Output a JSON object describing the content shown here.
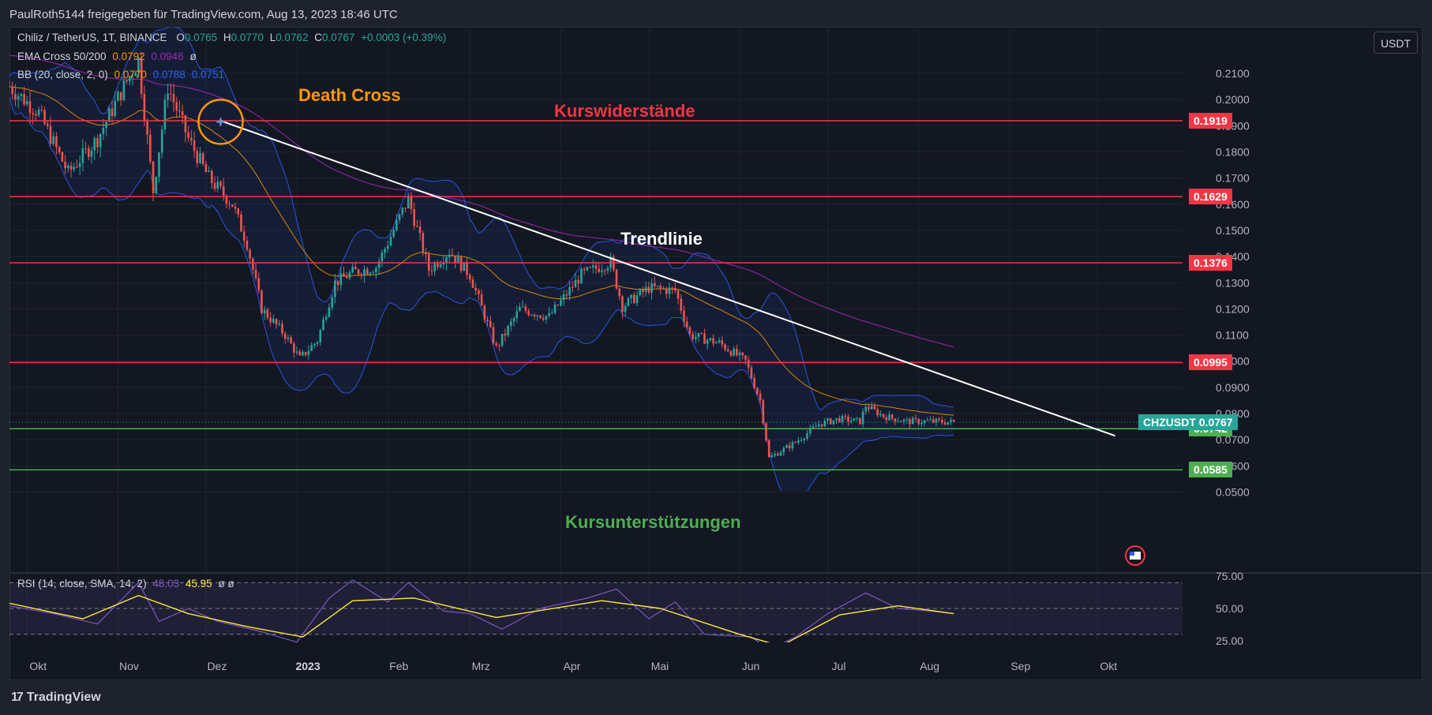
{
  "header": {
    "title": "PaulRoth5144 freigegeben für TradingView.com, Aug 13, 2023 18:46 UTC"
  },
  "legend": {
    "symbol": "Chiliz / TetherUS, 1T, BINANCE",
    "o_label": "O",
    "o_value": "0.0765",
    "h_label": "H",
    "h_value": "0.0770",
    "l_label": "L",
    "l_value": "0.0762",
    "c_label": "C",
    "c_value": "0.0767",
    "change": "+0.0003 (+0.39%)",
    "ema_label": "EMA Cross 50/200",
    "ema_v1": "0.0792",
    "ema_v2": "0.0946",
    "ema_icon": "ø",
    "bb_label": "BB (20, close, 2, 0)",
    "bb_v1": "0.0770",
    "bb_v2": "0.0788",
    "bb_v3": "0.0751",
    "rsi_label": "RSI (14, close, SMA, 14, 2)",
    "rsi_v1": "48.03",
    "rsi_v2": "45.95",
    "rsi_icons": "ø ø"
  },
  "currency_button": "USDT",
  "annotations": {
    "death_cross": "Death Cross",
    "resistance": "Kurswiderstände",
    "trendline": "Trendlinie",
    "support": "Kursunterstützungen"
  },
  "colors": {
    "up": "#26a69a",
    "down": "#ef5350",
    "resistance": "#f23645",
    "support": "#4caf50",
    "ema50": "#ff9800",
    "ema200": "#9c27b0",
    "bb": "#2962ff",
    "rsi": "#7e57c2",
    "rsi_sma": "#ffeb3b",
    "background": "#131722",
    "grid": "#1f2430",
    "text": "#b2b5be"
  },
  "footer": {
    "brand": "TradingView"
  },
  "chart_data": {
    "type": "candlestick",
    "symbol": "CHZUSDT",
    "current_price": "0.0767",
    "y_ticks": [
      "0.2100",
      "0.2000",
      "0.1900",
      "0.1800",
      "0.1700",
      "0.1600",
      "0.1500",
      "0.1400",
      "0.1300",
      "0.1200",
      "0.1100",
      "0.1000",
      "0.0900",
      "0.0800",
      "0.0700",
      "0.0600",
      "0.0500"
    ],
    "ylim": [
      0.048,
      0.225
    ],
    "x_ticks": [
      "Okt",
      "Nov",
      "Dez",
      "2023",
      "Feb",
      "Mrz",
      "Apr",
      "Mai",
      "Jun",
      "Jul",
      "Aug",
      "Sep",
      "Okt"
    ],
    "resistance_levels": [
      {
        "label": "0.1919",
        "value": 0.1919
      },
      {
        "label": "0.1629",
        "value": 0.1629
      },
      {
        "label": "0.1376",
        "value": 0.1376
      },
      {
        "label": "0.0995",
        "value": 0.0995
      }
    ],
    "support_levels": [
      {
        "label": "0.0742",
        "value": 0.0742
      },
      {
        "label": "0.0585",
        "value": 0.0585
      }
    ],
    "trendline": {
      "start": {
        "date": "2022-12-06",
        "price": 0.1919
      },
      "end": {
        "date": "2023-10-07",
        "price": 0.0715
      }
    },
    "death_cross": {
      "date": "2022-12-06",
      "price": 0.1915
    },
    "close_series": [
      {
        "date": "2022-09-25",
        "close": 0.205
      },
      {
        "date": "2022-10-05",
        "close": 0.195
      },
      {
        "date": "2022-10-15",
        "close": 0.172
      },
      {
        "date": "2022-10-25",
        "close": 0.185
      },
      {
        "date": "2022-11-03",
        "close": 0.205
      },
      {
        "date": "2022-11-08",
        "close": 0.215
      },
      {
        "date": "2022-11-13",
        "close": 0.165
      },
      {
        "date": "2022-11-18",
        "close": 0.205
      },
      {
        "date": "2022-11-25",
        "close": 0.185
      },
      {
        "date": "2022-12-02",
        "close": 0.17
      },
      {
        "date": "2022-12-10",
        "close": 0.16
      },
      {
        "date": "2022-12-15",
        "close": 0.145
      },
      {
        "date": "2022-12-20",
        "close": 0.12
      },
      {
        "date": "2022-12-28",
        "close": 0.11
      },
      {
        "date": "2023-01-02",
        "close": 0.101
      },
      {
        "date": "2023-01-08",
        "close": 0.108
      },
      {
        "date": "2023-01-14",
        "close": 0.13
      },
      {
        "date": "2023-01-20",
        "close": 0.134
      },
      {
        "date": "2023-01-28",
        "close": 0.136
      },
      {
        "date": "2023-02-08",
        "close": 0.162
      },
      {
        "date": "2023-02-15",
        "close": 0.135
      },
      {
        "date": "2023-02-22",
        "close": 0.142
      },
      {
        "date": "2023-03-01",
        "close": 0.133
      },
      {
        "date": "2023-03-10",
        "close": 0.105
      },
      {
        "date": "2023-03-18",
        "close": 0.12
      },
      {
        "date": "2023-03-28",
        "close": 0.117
      },
      {
        "date": "2023-04-08",
        "close": 0.133
      },
      {
        "date": "2023-04-18",
        "close": 0.138
      },
      {
        "date": "2023-04-22",
        "close": 0.121
      },
      {
        "date": "2023-05-01",
        "close": 0.128
      },
      {
        "date": "2023-05-10",
        "close": 0.127
      },
      {
        "date": "2023-05-15",
        "close": 0.11
      },
      {
        "date": "2023-05-25",
        "close": 0.107
      },
      {
        "date": "2023-06-03",
        "close": 0.1
      },
      {
        "date": "2023-06-08",
        "close": 0.085
      },
      {
        "date": "2023-06-11",
        "close": 0.063
      },
      {
        "date": "2023-06-20",
        "close": 0.069
      },
      {
        "date": "2023-06-28",
        "close": 0.076
      },
      {
        "date": "2023-07-05",
        "close": 0.078
      },
      {
        "date": "2023-07-12",
        "close": 0.077
      },
      {
        "date": "2023-07-14",
        "close": 0.083
      },
      {
        "date": "2023-07-20",
        "close": 0.079
      },
      {
        "date": "2023-07-28",
        "close": 0.077
      },
      {
        "date": "2023-08-05",
        "close": 0.077
      },
      {
        "date": "2023-08-13",
        "close": 0.0767
      }
    ],
    "rsi": {
      "y_ticks": [
        "75.00",
        "50.00",
        "25.00"
      ],
      "ylim": [
        20,
        80
      ],
      "rsi_series": [
        {
          "date": "2022-09-25",
          "value": 52
        },
        {
          "date": "2022-10-10",
          "value": 46
        },
        {
          "date": "2022-10-25",
          "value": 38
        },
        {
          "date": "2022-11-08",
          "value": 70
        },
        {
          "date": "2022-11-15",
          "value": 40
        },
        {
          "date": "2022-11-25",
          "value": 50
        },
        {
          "date": "2022-12-05",
          "value": 40
        },
        {
          "date": "2022-12-20",
          "value": 32
        },
        {
          "date": "2023-01-01",
          "value": 24
        },
        {
          "date": "2023-01-12",
          "value": 58
        },
        {
          "date": "2023-01-20",
          "value": 72
        },
        {
          "date": "2023-02-01",
          "value": 55
        },
        {
          "date": "2023-02-08",
          "value": 70
        },
        {
          "date": "2023-02-20",
          "value": 48
        },
        {
          "date": "2023-03-01",
          "value": 46
        },
        {
          "date": "2023-03-12",
          "value": 34
        },
        {
          "date": "2023-03-25",
          "value": 50
        },
        {
          "date": "2023-04-10",
          "value": 58
        },
        {
          "date": "2023-04-20",
          "value": 65
        },
        {
          "date": "2023-05-01",
          "value": 42
        },
        {
          "date": "2023-05-10",
          "value": 55
        },
        {
          "date": "2023-05-20",
          "value": 30
        },
        {
          "date": "2023-06-05",
          "value": 28
        },
        {
          "date": "2023-06-11",
          "value": 18
        },
        {
          "date": "2023-06-20",
          "value": 28
        },
        {
          "date": "2023-07-01",
          "value": 46
        },
        {
          "date": "2023-07-14",
          "value": 62
        },
        {
          "date": "2023-07-25",
          "value": 50
        },
        {
          "date": "2023-08-05",
          "value": 48
        },
        {
          "date": "2023-08-13",
          "value": 46
        }
      ],
      "sma_series": [
        {
          "date": "2022-09-25",
          "value": 54
        },
        {
          "date": "2022-10-20",
          "value": 42
        },
        {
          "date": "2022-11-08",
          "value": 60
        },
        {
          "date": "2022-11-25",
          "value": 46
        },
        {
          "date": "2022-12-15",
          "value": 36
        },
        {
          "date": "2023-01-03",
          "value": 28
        },
        {
          "date": "2023-01-20",
          "value": 56
        },
        {
          "date": "2023-02-10",
          "value": 58
        },
        {
          "date": "2023-03-10",
          "value": 43
        },
        {
          "date": "2023-04-15",
          "value": 56
        },
        {
          "date": "2023-05-05",
          "value": 50
        },
        {
          "date": "2023-06-01",
          "value": 30
        },
        {
          "date": "2023-06-15",
          "value": 21
        },
        {
          "date": "2023-07-05",
          "value": 45
        },
        {
          "date": "2023-07-25",
          "value": 52
        },
        {
          "date": "2023-08-13",
          "value": 46
        }
      ]
    }
  }
}
